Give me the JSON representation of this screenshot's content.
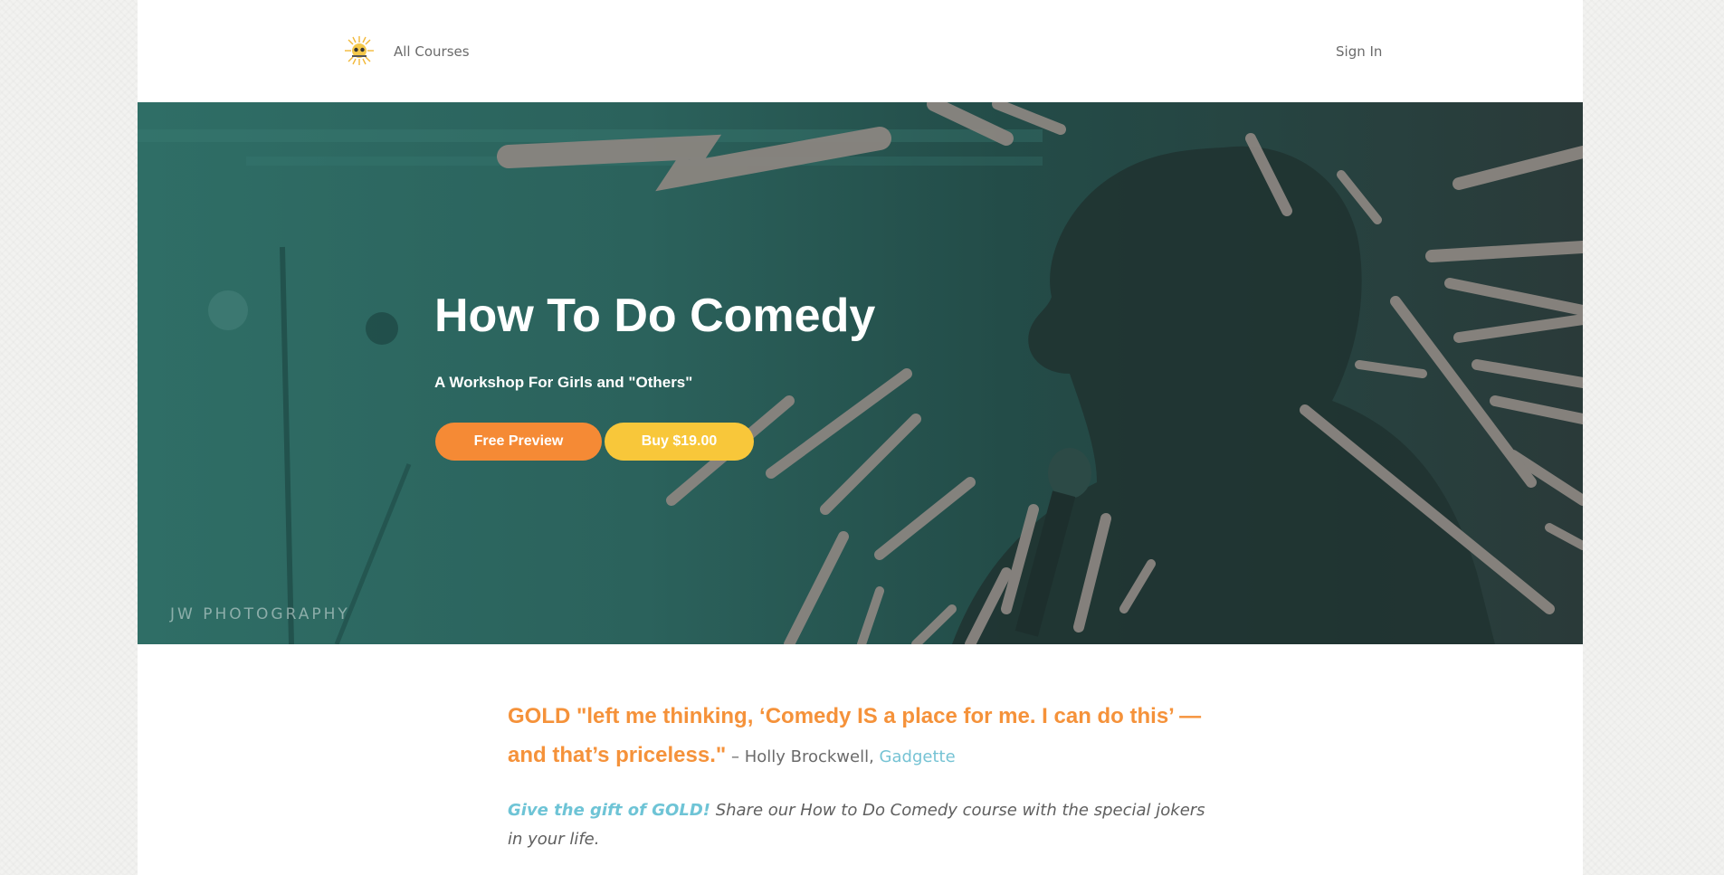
{
  "nav": {
    "logo_icon": "gold-comedy-sunburst-logo",
    "all_courses": "All Courses",
    "sign_in": "Sign In"
  },
  "hero": {
    "title": "How To Do Comedy",
    "subtitle": "A Workshop For Girls and \"Others\"",
    "watermark": "JW PHOTOGRAPHY",
    "preview_button": "Free Preview",
    "buy_button": "Buy $19.00"
  },
  "content": {
    "quote_strong": "GOLD \"left me thinking, ‘Comedy IS a place for me. I can do this’ — and that’s priceless.\"",
    "quote_attribution": " – Holly Brockwell, ",
    "quote_source": "Gadgette",
    "gift_link": "Give the gift of GOLD!",
    "gift_text": " Share our How to Do Comedy course with the special jokers in your life."
  },
  "colors": {
    "accent_orange": "#f58a35",
    "accent_yellow": "#f8c73a",
    "link_blue": "#76c3d4",
    "hero_teal": "#2f6e66"
  }
}
